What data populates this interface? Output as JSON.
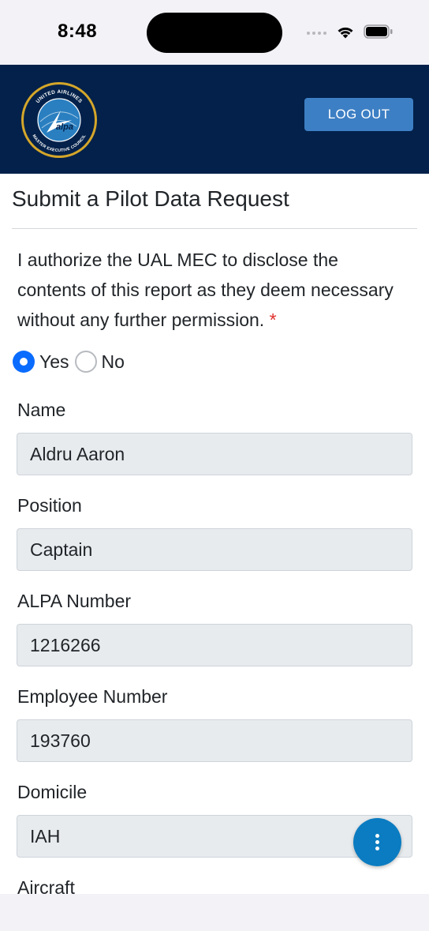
{
  "status_bar": {
    "time": "8:48"
  },
  "header": {
    "logo": {
      "arc_top": "UNITED AIRLINES",
      "arc_bottom": "MASTER EXECUTIVE COUNCIL",
      "center": "alpa"
    },
    "logout_label": "LOG OUT"
  },
  "form": {
    "title": "Submit a Pilot Data Request",
    "authorization_text": "I authorize the UAL MEC to disclose the contents of this report as they deem necessary without any further permission.",
    "required_marker": "*",
    "radio_yes": "Yes",
    "radio_no": "No",
    "selected": "Yes",
    "fields": [
      {
        "label": "Name",
        "value": "Aldru Aaron"
      },
      {
        "label": "Position",
        "value": "Captain"
      },
      {
        "label": "ALPA Number",
        "value": "1216266"
      },
      {
        "label": "Employee Number",
        "value": "193760"
      },
      {
        "label": "Domicile",
        "value": "IAH"
      },
      {
        "label": "Aircraft",
        "value": ""
      }
    ]
  },
  "colors": {
    "header_bg": "#03214a",
    "logout_bg": "#3d7fc4",
    "radio_checked": "#0a6cff",
    "required": "#e0302b",
    "fab_bg": "#0b7cc1"
  },
  "icons": {
    "fab": "more-vertical-icon"
  }
}
